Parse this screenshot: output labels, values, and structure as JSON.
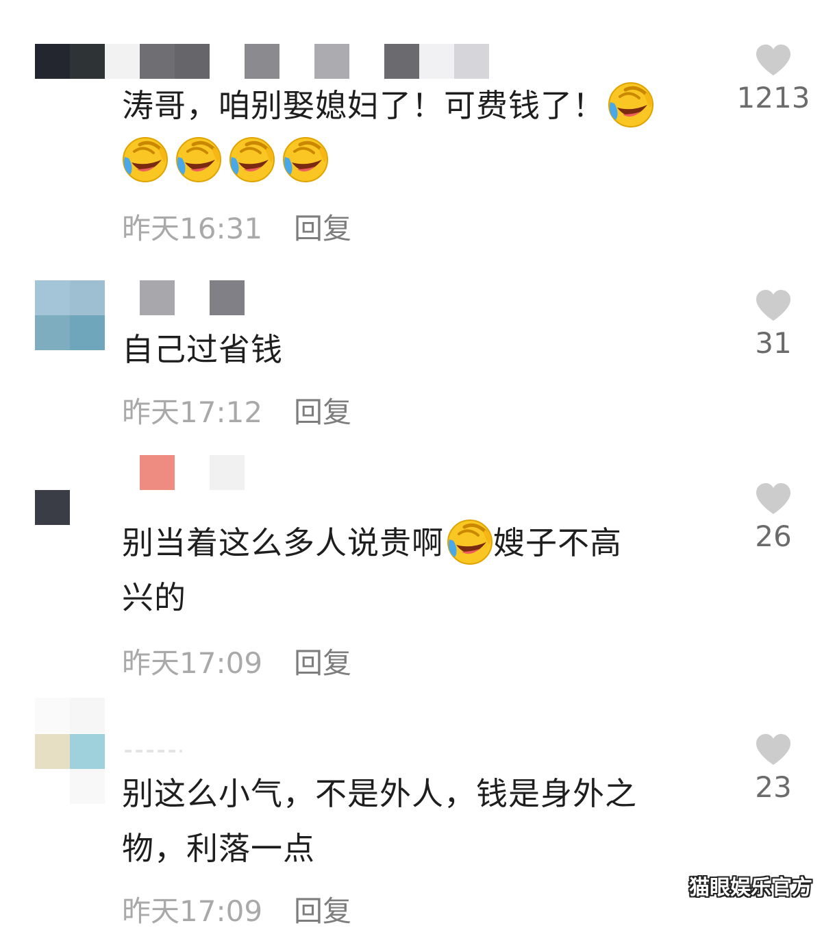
{
  "comments": [
    {
      "segments": [
        "涛哥，咱别娶媳妇了！可费钱了！",
        "",
        ""
      ],
      "time": "昨天16:31",
      "reply": "回复",
      "likes": "1213"
    },
    {
      "segments": [
        "自己过省钱"
      ],
      "time": "昨天17:12",
      "reply": "回复",
      "likes": "31"
    },
    {
      "segments": [
        "别当着这么多人说贵啊",
        "嫂子不高",
        "兴的"
      ],
      "time": "昨天17:09",
      "reply": "回复",
      "likes": "26"
    },
    {
      "segments": [
        "别这么小气，不是外人，钱是身外之",
        "物，利落一点"
      ],
      "time": "昨天17:09",
      "reply": "回复",
      "likes": "23"
    }
  ],
  "watermark": "猫眼娱乐官方",
  "icons": {
    "like": "heart-icon",
    "emoji": "laugh-cry-emoji-icon",
    "avatar": "pixelated-avatar"
  },
  "colors": {
    "heart": "#cccccc",
    "meta_text": "#a9a9a9",
    "reply_text": "#7d7d7d",
    "body_text": "#1e1e1e"
  }
}
